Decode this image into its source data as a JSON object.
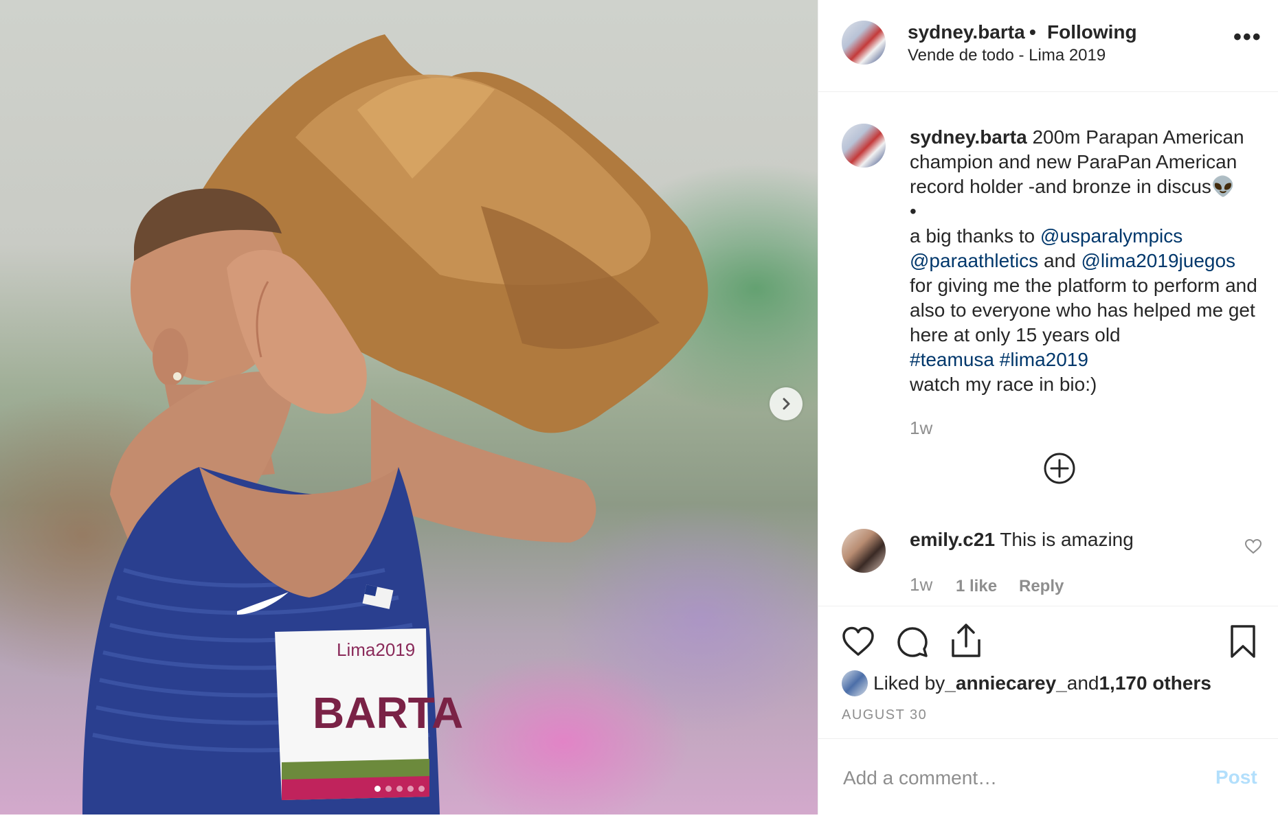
{
  "post": {
    "username": "sydney.barta",
    "separator": "•",
    "follow_status": "Following",
    "location": "Vende de todo - Lima 2019",
    "more_icon": "more-options-icon"
  },
  "photo": {
    "bib_event": "Lima2019",
    "bib_name": "BARTA",
    "carousel": {
      "total": 5,
      "active": 1
    }
  },
  "caption": {
    "username": "sydney.barta",
    "line1": " 200m Parapan American champion and new ParaPan American record holder -and bronze in discus👽",
    "bullet": "•",
    "thanks_prefix": "a big thanks to ",
    "mention1": "@usparalympics",
    "mention2": "@paraathletics",
    "and": " and ",
    "mention3": "@lima2019juegos",
    "body": "for giving me the platform to perform and also to everyone who has helped me get here at only 15 years old",
    "hashtag1": "#teamusa",
    "hashtag2": "#lima2019",
    "closing": "watch my race in bio:)",
    "time": "1w"
  },
  "comment": {
    "username": "emily.c21",
    "text": " This is amazing",
    "time": "1w",
    "likes": "1 like",
    "reply": "Reply"
  },
  "likes": {
    "prefix": "Liked by ",
    "user": "_anniecarey_",
    "middle": " and ",
    "others": "1,170 others"
  },
  "date": "AUGUST 30",
  "add_comment": {
    "placeholder": "Add a comment…",
    "post_label": "Post"
  },
  "colors": {
    "link": "#00376b",
    "muted": "#8e8e8e",
    "post_disabled": "#b2dffc"
  }
}
